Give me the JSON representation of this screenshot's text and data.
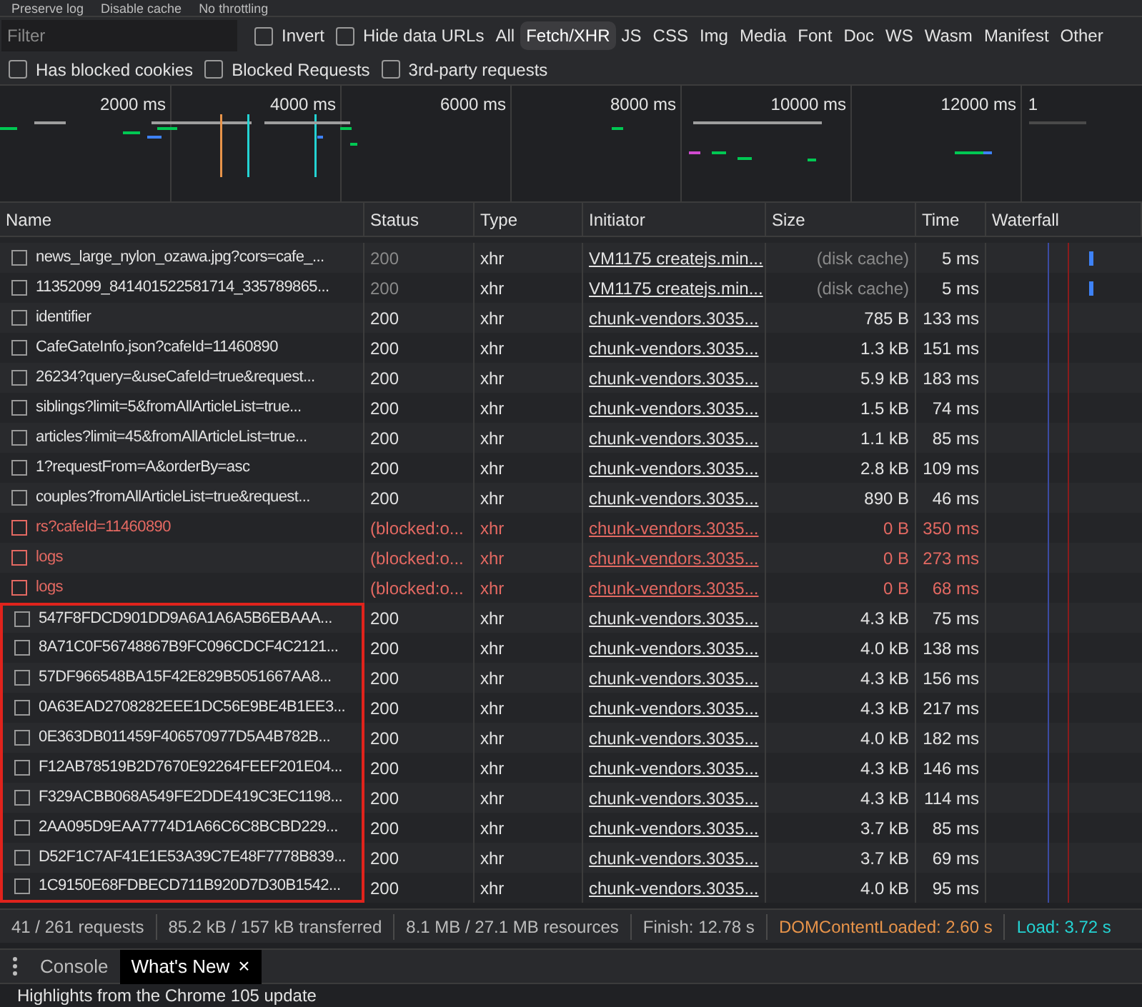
{
  "toolbar": [
    "Preserve log",
    "Disable cache",
    "No throttling"
  ],
  "filter": {
    "placeholder": "Filter"
  },
  "filter_options": [
    {
      "label": "Invert",
      "checked": false
    },
    {
      "label": "Hide data URLs",
      "checked": false
    }
  ],
  "type_filters": [
    {
      "label": "All",
      "selected": false
    },
    {
      "label": "Fetch/XHR",
      "selected": true
    },
    {
      "label": "JS",
      "selected": false
    },
    {
      "label": "CSS",
      "selected": false
    },
    {
      "label": "Img",
      "selected": false
    },
    {
      "label": "Media",
      "selected": false
    },
    {
      "label": "Font",
      "selected": false
    },
    {
      "label": "Doc",
      "selected": false
    },
    {
      "label": "WS",
      "selected": false
    },
    {
      "label": "Wasm",
      "selected": false
    },
    {
      "label": "Manifest",
      "selected": false
    },
    {
      "label": "Other",
      "selected": false
    }
  ],
  "extra_filters": [
    {
      "label": "Has blocked cookies",
      "checked": false
    },
    {
      "label": "Blocked Requests",
      "checked": false
    },
    {
      "label": "3rd-party requests",
      "checked": false
    }
  ],
  "overview": {
    "ticks": [
      "2000 ms",
      "4000 ms",
      "6000 ms",
      "8000 ms",
      "10000 ms",
      "12000 ms",
      "1"
    ]
  },
  "table": {
    "columns": [
      "Name",
      "Status",
      "Type",
      "Initiator",
      "Size",
      "Time",
      "Waterfall"
    ],
    "rows": [
      {
        "kind": "cached",
        "name": "news_large_nylon_ozawa.jpg?cors=cafe_...",
        "status": "200",
        "type": "xhr",
        "initiator": "VM1175 createjs.min...",
        "size": "(disk cache)",
        "time": "5 ms",
        "highlighted": false
      },
      {
        "kind": "cached",
        "name": "11352099_841401522581714_335789865...",
        "status": "200",
        "type": "xhr",
        "initiator": "VM1175 createjs.min...",
        "size": "(disk cache)",
        "time": "5 ms",
        "highlighted": false
      },
      {
        "kind": "normal",
        "name": "identifier",
        "status": "200",
        "type": "xhr",
        "initiator": "chunk-vendors.3035...",
        "size": "785 B",
        "time": "133 ms",
        "highlighted": false
      },
      {
        "kind": "normal",
        "name": "CafeGateInfo.json?cafeId=11460890",
        "status": "200",
        "type": "xhr",
        "initiator": "chunk-vendors.3035...",
        "size": "1.3 kB",
        "time": "151 ms",
        "highlighted": false
      },
      {
        "kind": "normal",
        "name": "26234?query=&useCafeId=true&request...",
        "status": "200",
        "type": "xhr",
        "initiator": "chunk-vendors.3035...",
        "size": "5.9 kB",
        "time": "183 ms",
        "highlighted": false
      },
      {
        "kind": "normal",
        "name": "siblings?limit=5&fromAllArticleList=true...",
        "status": "200",
        "type": "xhr",
        "initiator": "chunk-vendors.3035...",
        "size": "1.5 kB",
        "time": "74 ms",
        "highlighted": false
      },
      {
        "kind": "normal",
        "name": "articles?limit=45&fromAllArticleList=true...",
        "status": "200",
        "type": "xhr",
        "initiator": "chunk-vendors.3035...",
        "size": "1.1 kB",
        "time": "85 ms",
        "highlighted": false
      },
      {
        "kind": "normal",
        "name": "1?requestFrom=A&orderBy=asc",
        "status": "200",
        "type": "xhr",
        "initiator": "chunk-vendors.3035...",
        "size": "2.8 kB",
        "time": "109 ms",
        "highlighted": false
      },
      {
        "kind": "normal",
        "name": "couples?fromAllArticleList=true&request...",
        "status": "200",
        "type": "xhr",
        "initiator": "chunk-vendors.3035...",
        "size": "890 B",
        "time": "46 ms",
        "highlighted": false
      },
      {
        "kind": "blocked",
        "name": "rs?cafeId=11460890",
        "status": "(blocked:o...",
        "type": "xhr",
        "initiator": "chunk-vendors.3035...",
        "size": "0 B",
        "time": "350 ms",
        "highlighted": false
      },
      {
        "kind": "blocked",
        "name": "logs",
        "status": "(blocked:o...",
        "type": "xhr",
        "initiator": "chunk-vendors.3035...",
        "size": "0 B",
        "time": "273 ms",
        "highlighted": false
      },
      {
        "kind": "blocked",
        "name": "logs",
        "status": "(blocked:o...",
        "type": "xhr",
        "initiator": "chunk-vendors.3035...",
        "size": "0 B",
        "time": "68 ms",
        "highlighted": false
      },
      {
        "kind": "normal",
        "name": "547F8FDCD901DD9A6A1A6A5B6EBAAA...",
        "status": "200",
        "type": "xhr",
        "initiator": "chunk-vendors.3035...",
        "size": "4.3 kB",
        "time": "75 ms",
        "highlighted": true
      },
      {
        "kind": "normal",
        "name": "8A71C0F56748867B9FC096CDCF4C2121...",
        "status": "200",
        "type": "xhr",
        "initiator": "chunk-vendors.3035...",
        "size": "4.0 kB",
        "time": "138 ms",
        "highlighted": true
      },
      {
        "kind": "normal",
        "name": "57DF966548BA15F42E829B5051667AA8...",
        "status": "200",
        "type": "xhr",
        "initiator": "chunk-vendors.3035...",
        "size": "4.3 kB",
        "time": "156 ms",
        "highlighted": true
      },
      {
        "kind": "normal",
        "name": "0A63EAD2708282EEE1DC56E9BE4B1EE3...",
        "status": "200",
        "type": "xhr",
        "initiator": "chunk-vendors.3035...",
        "size": "4.3 kB",
        "time": "217 ms",
        "highlighted": true
      },
      {
        "kind": "normal",
        "name": "0E363DB011459F406570977D5A4B782B...",
        "status": "200",
        "type": "xhr",
        "initiator": "chunk-vendors.3035...",
        "size": "4.0 kB",
        "time": "182 ms",
        "highlighted": true
      },
      {
        "kind": "normal",
        "name": "F12AB78519B2D7670E92264FEEF201E04...",
        "status": "200",
        "type": "xhr",
        "initiator": "chunk-vendors.3035...",
        "size": "4.3 kB",
        "time": "146 ms",
        "highlighted": true
      },
      {
        "kind": "normal",
        "name": "F329ACBB068A549FE2DDE419C3EC1198...",
        "status": "200",
        "type": "xhr",
        "initiator": "chunk-vendors.3035...",
        "size": "4.3 kB",
        "time": "114 ms",
        "highlighted": true
      },
      {
        "kind": "normal",
        "name": "2AA095D9EAA7774D1A66C6C8BCBD229...",
        "status": "200",
        "type": "xhr",
        "initiator": "chunk-vendors.3035...",
        "size": "3.7 kB",
        "time": "85 ms",
        "highlighted": true
      },
      {
        "kind": "normal",
        "name": "D52F1C7AF41E1E53A39C7E48F7778B839...",
        "status": "200",
        "type": "xhr",
        "initiator": "chunk-vendors.3035...",
        "size": "3.7 kB",
        "time": "69 ms",
        "highlighted": true
      },
      {
        "kind": "normal",
        "name": "1C9150E68FDBECD711B920D7D30B1542...",
        "status": "200",
        "type": "xhr",
        "initiator": "chunk-vendors.3035...",
        "size": "4.0 kB",
        "time": "95 ms",
        "highlighted": true
      }
    ]
  },
  "status_bar": [
    {
      "kind": "plain",
      "text": "41 / 261 requests"
    },
    {
      "kind": "plain",
      "text": "85.2 kB / 157 kB transferred"
    },
    {
      "kind": "plain",
      "text": "8.1 MB / 27.1 MB resources"
    },
    {
      "kind": "plain",
      "text": "Finish: 12.78 s"
    },
    {
      "kind": "dom",
      "text": "DOMContentLoaded: 2.60 s"
    },
    {
      "kind": "load",
      "text": "Load: 3.72 s"
    }
  ],
  "drawer_tabs": [
    {
      "label": "Console",
      "selected": false,
      "closable": false
    },
    {
      "label": "What's New",
      "selected": true,
      "closable": true
    }
  ],
  "close_glyph": "×",
  "drawer_text": "Highlights from the Chrome 105 update"
}
